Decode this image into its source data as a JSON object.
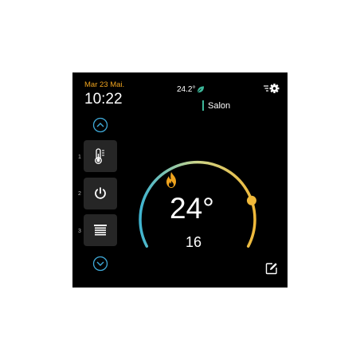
{
  "header": {
    "date": "Mar 23 Mai.",
    "time": "10:22",
    "outside_temp": "24.2°",
    "room_name": "Salon"
  },
  "modes": [
    {
      "number": "1",
      "icon": "thermometer-icon"
    },
    {
      "number": "2",
      "icon": "power-icon"
    },
    {
      "number": "3",
      "icon": "shutter-icon"
    }
  ],
  "thermostat": {
    "setpoint": "24°",
    "current": "16",
    "level_fraction": 0.8
  },
  "colors": {
    "accent_orange": "#f0a41e",
    "accent_blue": "#3fa9d8",
    "leaf_green": "#3db89a",
    "arc_teal": "#4cbccc",
    "arc_yellow": "#f0b93a"
  },
  "icons": [
    "settings-gear-icon",
    "leaf-icon",
    "chevron-up-icon",
    "chevron-down-icon",
    "flame-icon",
    "edit-icon"
  ]
}
